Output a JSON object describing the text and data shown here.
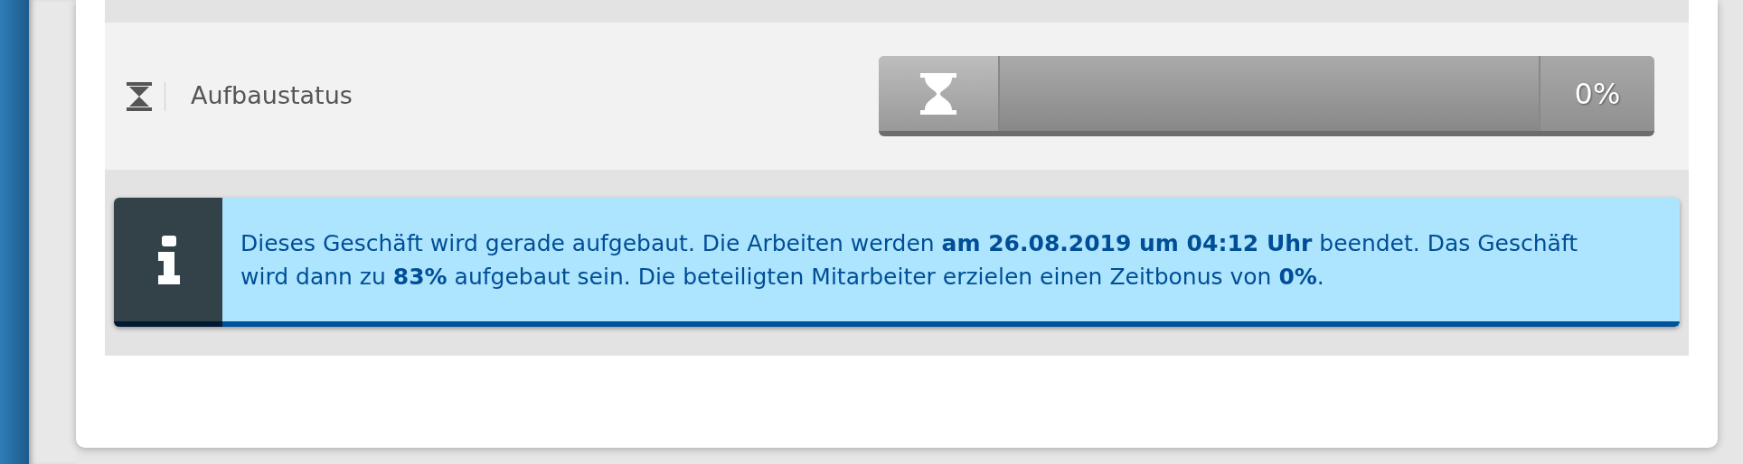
{
  "status_row": {
    "label": "Aufbaustatus",
    "progress": {
      "reading": "0%"
    }
  },
  "info_message": {
    "text": "Dieses Geschäft wird gerade aufgebaut. Die Arbeiten werden **am 26.08.2019 um 04:12 Uhr** beendet. Das Geschäft wird dann zu **83%** aufgebaut sein. Die beteiligten Mitarbeiter erzielen einen Zeitbonus von **0%**."
  }
}
